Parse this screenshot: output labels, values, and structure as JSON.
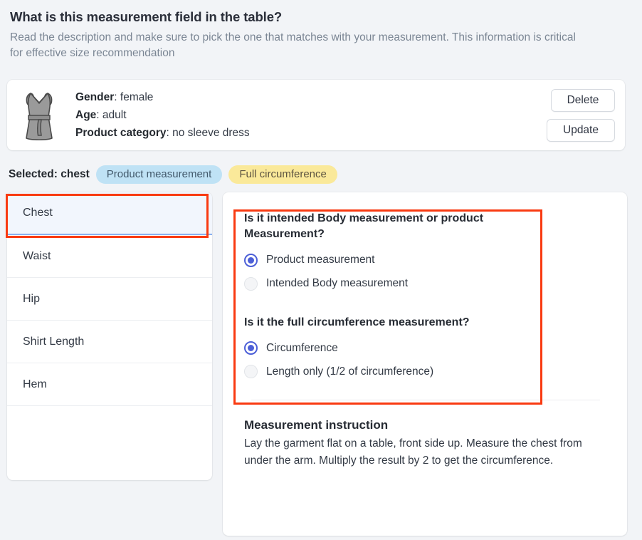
{
  "header": {
    "title": "What is this measurement field in the table?",
    "subtitle": "Read the description and make sure to pick the one that matches with your measurement. This information is critical for effective size recommendation"
  },
  "product_card": {
    "icon": "dress-icon",
    "fields": [
      {
        "label": "Gender",
        "separator": ": ",
        "value": "female"
      },
      {
        "label": "Age",
        "separator": ": ",
        "value": "adult"
      },
      {
        "label": "Product category",
        "separator": ": ",
        "value": "no sleeve dress"
      }
    ],
    "delete_label": "Delete",
    "update_label": "Update"
  },
  "selected_row": {
    "prefix": "Selected",
    "separator": ": ",
    "value": "chest",
    "badges": [
      {
        "text": "Product measurement",
        "color": "#bfe2f5"
      },
      {
        "text": "Full circumference",
        "color": "#fae99a"
      }
    ]
  },
  "measurement_list": {
    "items": [
      {
        "label": "Chest",
        "selected": true
      },
      {
        "label": "Waist",
        "selected": false
      },
      {
        "label": "Hip",
        "selected": false
      },
      {
        "label": "Shirt Length",
        "selected": false
      },
      {
        "label": "Hem",
        "selected": false
      }
    ]
  },
  "detail": {
    "question1": {
      "heading": "Is it intended Body measurement or product Measurement?",
      "options": [
        {
          "label": "Product measurement",
          "checked": true
        },
        {
          "label": "Intended Body measurement",
          "checked": false
        }
      ]
    },
    "question2": {
      "heading": "Is it the full circumference measurement?",
      "options": [
        {
          "label": "Circumference",
          "checked": true
        },
        {
          "label": "Length only (1/2 of circumference)",
          "checked": false
        }
      ]
    },
    "instruction": {
      "title": "Measurement instruction",
      "body": "Lay the garment flat on a table, front side up. Measure the chest from under the arm. Multiply the result by 2 to get the circumference."
    }
  },
  "annotations": {
    "color": "#f93a11",
    "boxes": [
      "chest-list-item",
      "question-group"
    ]
  }
}
